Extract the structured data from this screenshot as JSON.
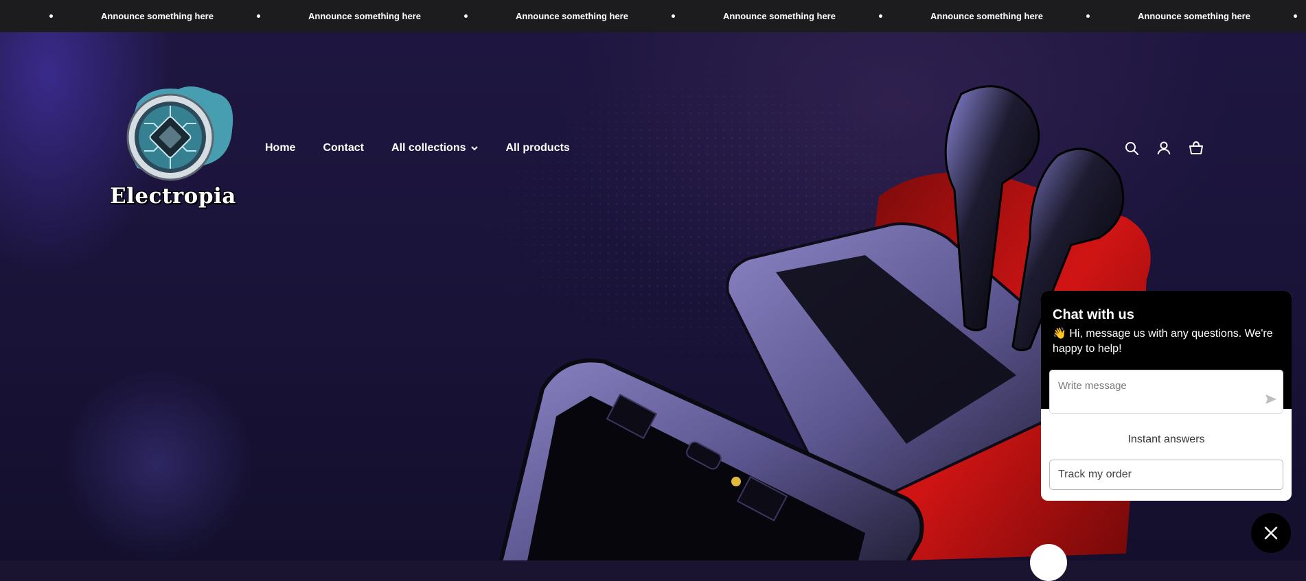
{
  "announcement": {
    "items": [
      "Announce something here",
      "Announce something here",
      "Announce something here",
      "Announce something here",
      "Announce something here",
      "Announce something here"
    ]
  },
  "brand": {
    "name": "Electropia"
  },
  "nav": {
    "home": "Home",
    "contact": "Contact",
    "all_collections": "All collections",
    "all_products": "All products"
  },
  "header_icons": [
    "search-icon",
    "account-icon",
    "cart-icon"
  ],
  "chat": {
    "title": "Chat with us",
    "subtitle": "👋 Hi, message us with any questions. We're happy to help!",
    "input_placeholder": "Write message",
    "instant_answers": "Instant answers",
    "track_order": "Track my order"
  },
  "colors": {
    "announce_bg": "#1c1c1e",
    "chat_header": "#000000",
    "accent_red": "#d11414"
  }
}
